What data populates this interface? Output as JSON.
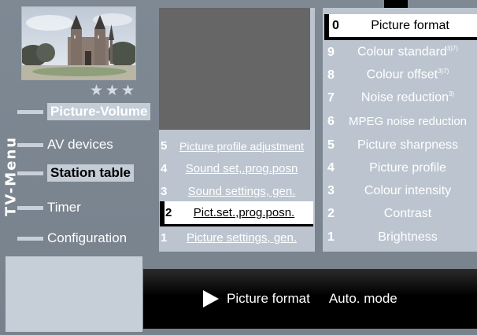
{
  "side_label": "TV-Menu",
  "rating_stars": "★★★",
  "menu": {
    "items": [
      {
        "label": "Picture-Volume",
        "state": "highlight"
      },
      {
        "label": "AV devices",
        "state": ""
      },
      {
        "label": "Station table",
        "state": "selected"
      },
      {
        "label": "Timer",
        "state": ""
      },
      {
        "label": "Configuration",
        "state": ""
      }
    ]
  },
  "middle": {
    "rows": [
      {
        "num": "5",
        "label": "Picture profile adjustment"
      },
      {
        "num": "4",
        "label": "Sound set,.prog.posn"
      },
      {
        "num": "3",
        "label": "Sound settings, gen."
      },
      {
        "num": "2",
        "label": "Pict.set.,prog.posn."
      },
      {
        "num": "1",
        "label": "Picture settings, gen."
      }
    ]
  },
  "right": {
    "rows": [
      {
        "num": "0",
        "label": "Picture format",
        "sup": ""
      },
      {
        "num": "9",
        "label": "Colour  standard",
        "sup": "3)7)"
      },
      {
        "num": "8",
        "label": "Colour offset",
        "sup": "3)7)"
      },
      {
        "num": "7",
        "label": "Noise reduction",
        "sup": "3)"
      },
      {
        "num": "6",
        "label": "MPEG noise reduction",
        "sup": ""
      },
      {
        "num": "5",
        "label": "Picture sharpness",
        "sup": ""
      },
      {
        "num": "4",
        "label": "Picture  profile",
        "sup": ""
      },
      {
        "num": "3",
        "label": "Colour intensity",
        "sup": ""
      },
      {
        "num": "2",
        "label": "Contrast",
        "sup": ""
      },
      {
        "num": "1",
        "label": "Brightness",
        "sup": ""
      }
    ]
  },
  "status": {
    "item": "Picture format",
    "value": "Auto. mode"
  }
}
